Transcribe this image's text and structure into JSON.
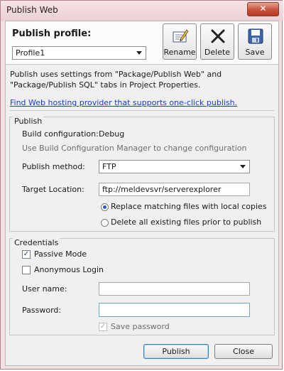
{
  "window": {
    "title": "Publish Web",
    "close_glyph": "✕"
  },
  "header": {
    "profile_label": "Publish profile:",
    "profile_value": "Profile1",
    "buttons": [
      {
        "label": "Rename",
        "icon": "rename-icon"
      },
      {
        "label": "Delete",
        "icon": "delete-icon"
      },
      {
        "label": "Save",
        "icon": "save-icon"
      }
    ]
  },
  "description": "Publish uses settings from \"Package/Publish Web\" and \"Package/Publish SQL\" tabs in Project Properties.",
  "link_text": "Find Web hosting provider that supports one-click publish.",
  "publish": {
    "group_label": "Publish",
    "build_config_label": "Build configuration:",
    "build_config_value": "Debug",
    "build_config_hint": "Use Build Configuration Manager to change configuration",
    "method_label": "Publish method:",
    "method_value": "FTP",
    "target_label": "Target Location:",
    "target_value": "ftp://meldevsvr/serverexplorer",
    "radio_replace": "Replace matching files with local copies",
    "radio_delete": "Delete all existing files prior to publish",
    "selected_option": "replace"
  },
  "credentials": {
    "group_label": "Credentials",
    "passive_mode": "Passive Mode",
    "passive_checked": true,
    "anonymous_login": "Anonymous Login",
    "anonymous_checked": false,
    "user_label": "User name:",
    "user_value": "",
    "password_label": "Password:",
    "password_value": "",
    "save_password": "Save password",
    "save_password_checked": true
  },
  "footer": {
    "publish_label": "Publish",
    "close_label": "Close"
  },
  "colors": {
    "link": "#1a3cd0",
    "title_bar": "#f2dfe2",
    "close_button": "#c7503b"
  }
}
